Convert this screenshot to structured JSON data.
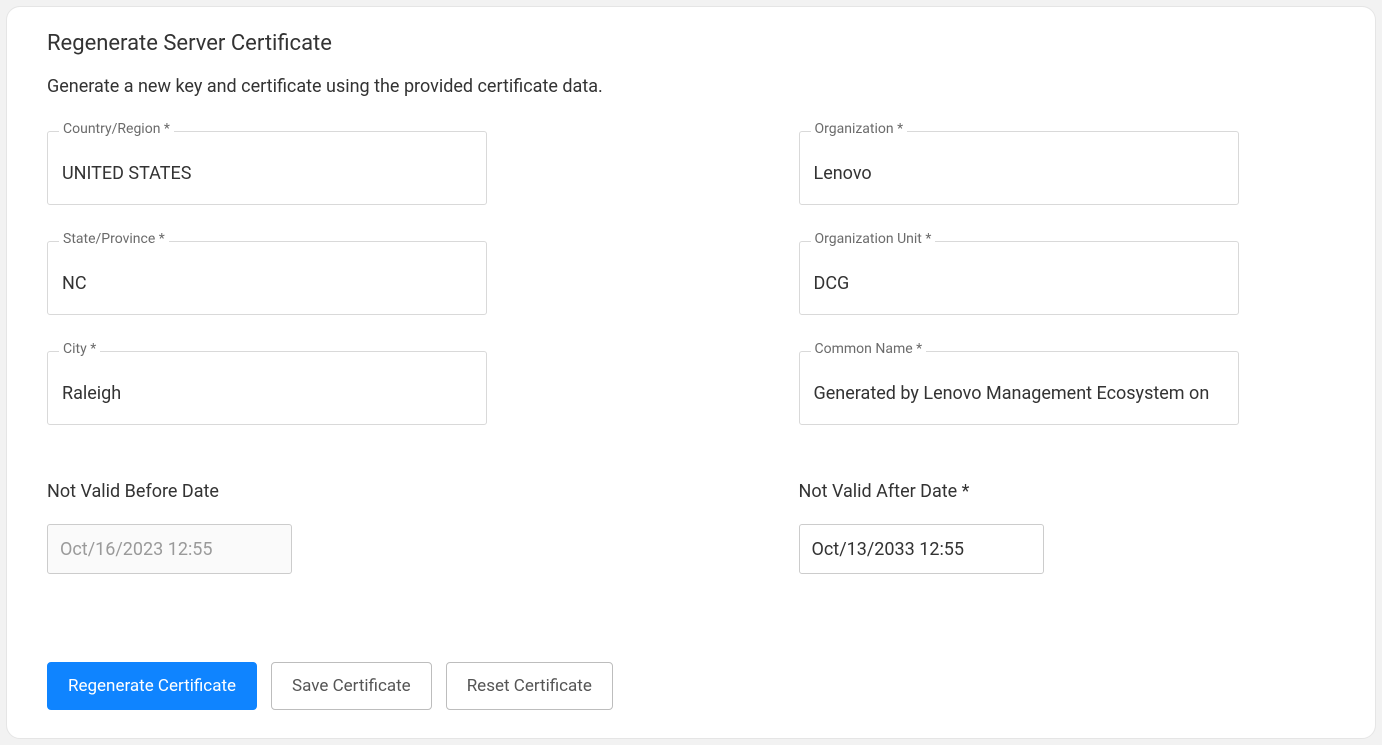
{
  "header": {
    "title": "Regenerate Server Certificate",
    "subtitle": "Generate a new key and certificate using the provided certificate data."
  },
  "fields": {
    "country": {
      "label": "Country/Region *",
      "value": "UNITED STATES"
    },
    "organization": {
      "label": "Organization *",
      "value": "Lenovo"
    },
    "state": {
      "label": "State/Province *",
      "value": "NC"
    },
    "org_unit": {
      "label": "Organization Unit *",
      "value": "DCG"
    },
    "city": {
      "label": "City *",
      "value": "Raleigh"
    },
    "common_name": {
      "label": "Common Name *",
      "value": "Generated by Lenovo Management Ecosystem on"
    }
  },
  "dates": {
    "not_before": {
      "label": "Not Valid Before Date",
      "value": "Oct/16/2023 12:55"
    },
    "not_after": {
      "label": "Not Valid After Date *",
      "value": "Oct/13/2033 12:55"
    }
  },
  "buttons": {
    "regenerate": "Regenerate Certificate",
    "save": "Save Certificate",
    "reset": "Reset Certificate"
  }
}
